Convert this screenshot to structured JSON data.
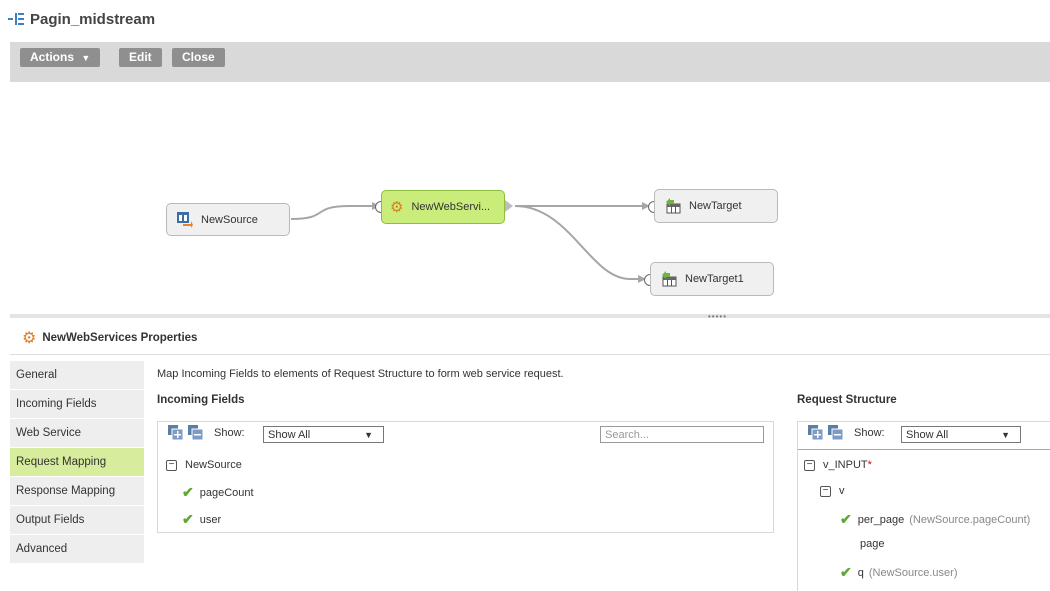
{
  "page": {
    "title": "Pagin_midstream"
  },
  "toolbar": {
    "actions": "Actions",
    "edit": "Edit",
    "close": "Close"
  },
  "canvas": {
    "nodes": {
      "source": "NewSource",
      "webservice": "NewWebServi...",
      "target": "NewTarget",
      "target1": "NewTarget1"
    }
  },
  "properties": {
    "title": "NewWebServices Properties",
    "tabs": [
      "General",
      "Incoming Fields",
      "Web Service",
      "Request Mapping",
      "Response Mapping",
      "Output Fields",
      "Advanced"
    ],
    "active_tab": "Request Mapping",
    "instruction": "Map Incoming Fields to elements of Request Structure to form web service request.",
    "incoming": {
      "heading": "Incoming Fields",
      "show_label": "Show:",
      "show_value": "Show All",
      "search_placeholder": "Search...",
      "tree": {
        "root": "NewSource",
        "fields": [
          "pageCount",
          "user"
        ]
      }
    },
    "request": {
      "heading": "Request Structure",
      "show_label": "Show:",
      "show_value": "Show All",
      "tree": {
        "root": "v_INPUT",
        "required_mark": "*",
        "child": "v",
        "leaves": [
          {
            "name": "per_page",
            "mapping": "(NewSource.pageCount)"
          },
          {
            "name": "page",
            "mapping": ""
          },
          {
            "name": "q",
            "mapping": "(NewSource.user)"
          }
        ]
      }
    }
  },
  "colors": {
    "active_tab": "#d7ec9c",
    "selected_node": "#c9ec7a",
    "check": "#5fa833",
    "button": "#8f8f8f"
  }
}
